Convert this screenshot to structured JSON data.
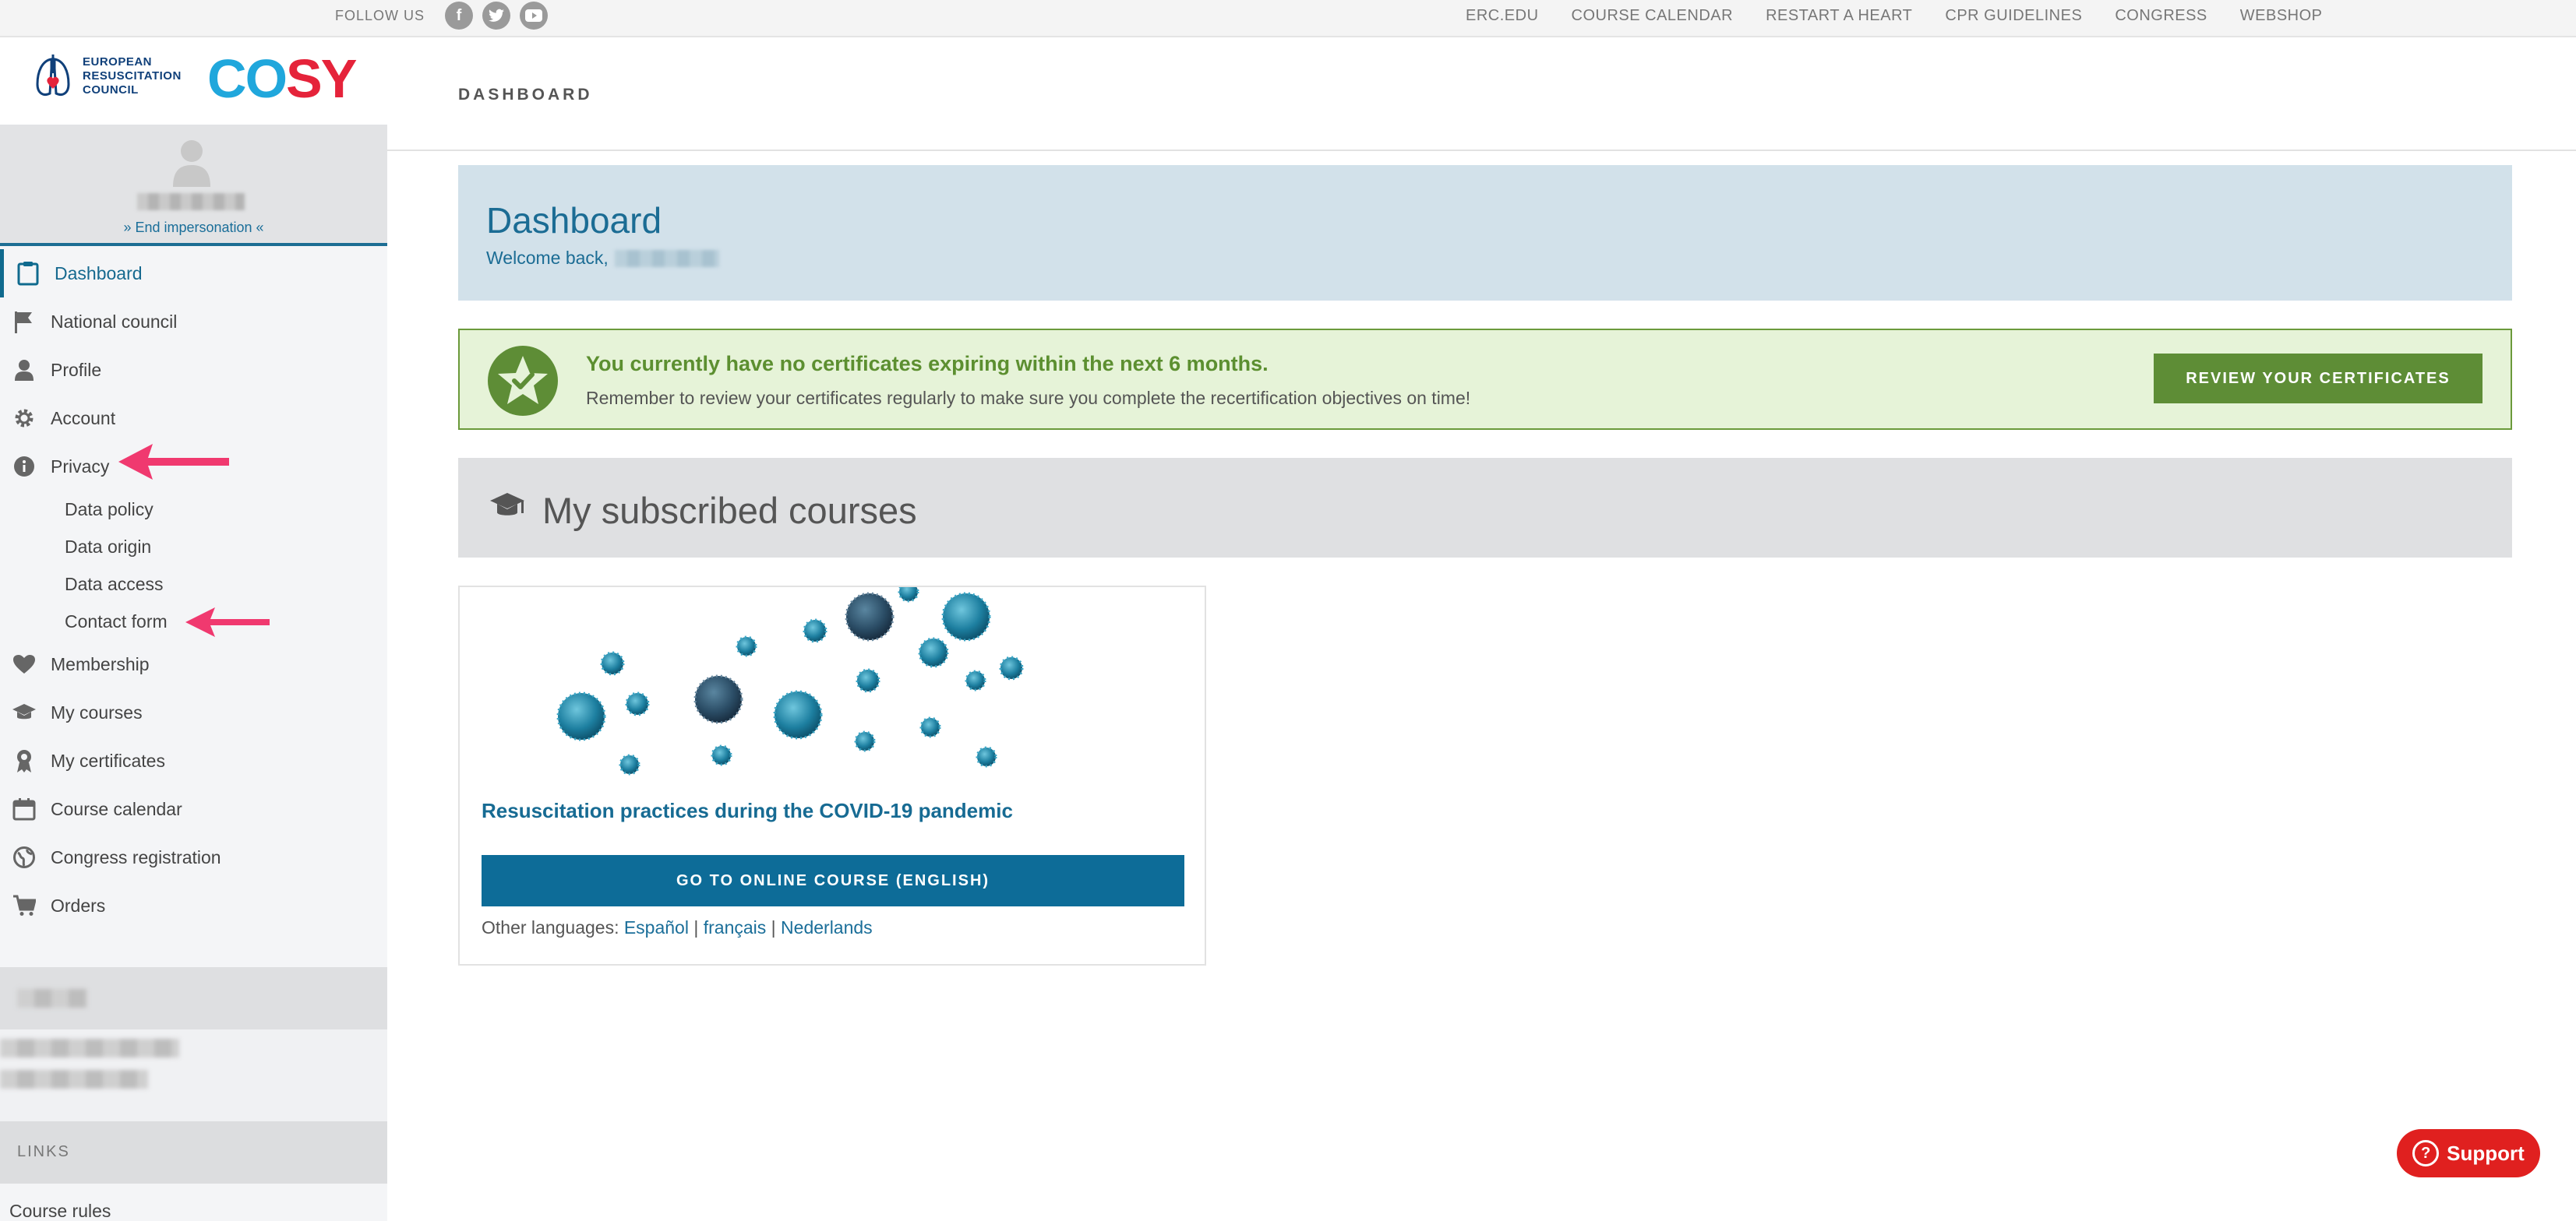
{
  "topbar": {
    "follow_label": "FOLLOW US",
    "social": [
      {
        "icon": "facebook-icon",
        "glyph": "f"
      },
      {
        "icon": "twitter-icon",
        "glyph": "t"
      },
      {
        "icon": "youtube-icon",
        "glyph": "▶"
      }
    ],
    "nav": [
      "ERC.EDU",
      "COURSE CALENDAR",
      "RESTART A HEART",
      "CPR GUIDELINES",
      "CONGRESS",
      "WEBSHOP"
    ]
  },
  "brand": {
    "erc_line1": "EUROPEAN",
    "erc_line2": "RESUSCITATION",
    "erc_line3": "COUNCIL",
    "cosy": [
      "C",
      "O",
      "S",
      "Y"
    ]
  },
  "user": {
    "end_impersonation": "» End impersonation «"
  },
  "sidebar": {
    "items": [
      {
        "label": "Dashboard",
        "icon": "clipboard-icon",
        "active": true
      },
      {
        "label": "National council",
        "icon": "flag-icon"
      },
      {
        "label": "Profile",
        "icon": "user-icon"
      },
      {
        "label": "Account",
        "icon": "gear-icon"
      },
      {
        "label": "Privacy",
        "icon": "info-icon"
      }
    ],
    "privacy_sub": [
      "Data policy",
      "Data origin",
      "Data access",
      "Contact form"
    ],
    "items2": [
      {
        "label": "Membership",
        "icon": "heart-icon"
      },
      {
        "label": "My courses",
        "icon": "graduation-cap-icon"
      },
      {
        "label": "My certificates",
        "icon": "award-icon"
      },
      {
        "label": "Course calendar",
        "icon": "calendar-icon"
      },
      {
        "label": "Congress registration",
        "icon": "globe-icon"
      },
      {
        "label": "Orders",
        "icon": "cart-icon"
      }
    ],
    "links_heading": "LINKS",
    "course_rules": "Course rules"
  },
  "main": {
    "page_heading": "DASHBOARD",
    "dashboard_title": "Dashboard",
    "welcome": "Welcome back,",
    "cert_title": "You currently have no certificates expiring within the next 6 months.",
    "cert_sub": "Remember to review your certificates regularly to make sure you complete the recertification objectives on time!",
    "cert_button": "REVIEW YOUR CERTIFICATES",
    "courses_heading": "My subscribed courses",
    "course": {
      "title": "Resuscitation practices during the COVID-19 pandemic",
      "button": "GO TO ONLINE COURSE (ENGLISH)",
      "other_label": "Other languages:",
      "languages": [
        "Español",
        "français",
        "Nederlands"
      ]
    }
  },
  "support": {
    "label": "Support"
  },
  "colors": {
    "accent": "#0d6c98",
    "success": "#5e8d36",
    "support": "#e0201f",
    "arrow": "#f0396f"
  }
}
